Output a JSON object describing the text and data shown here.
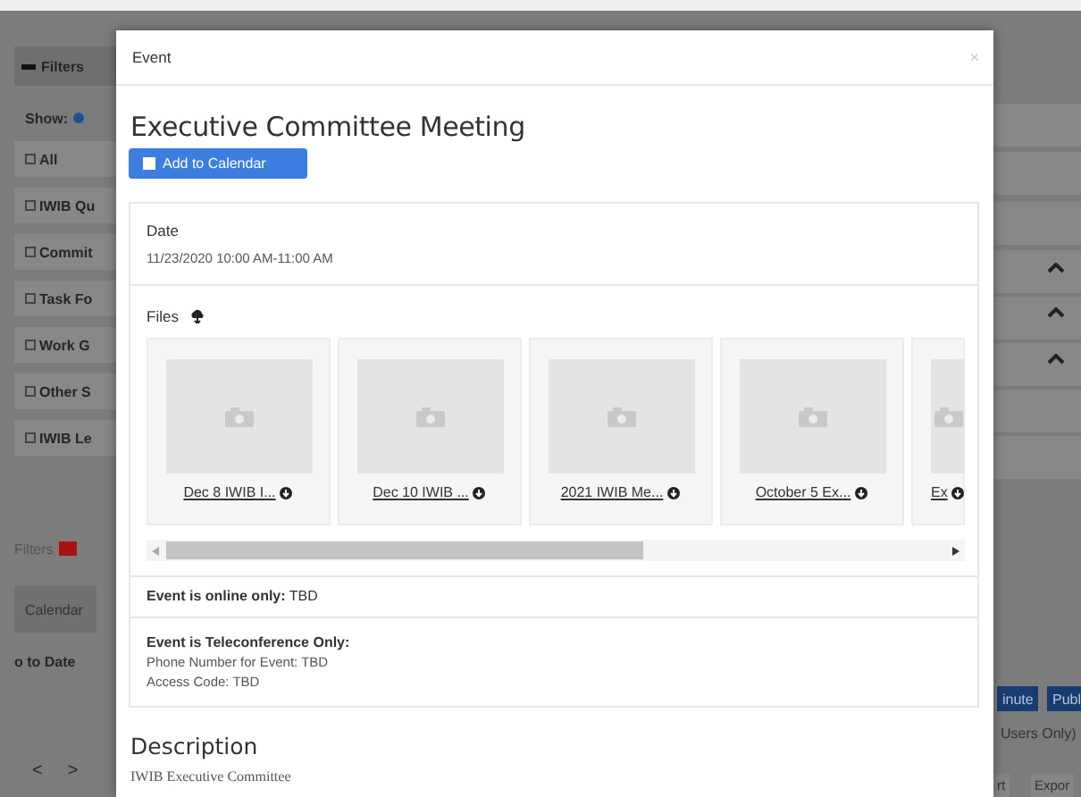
{
  "background": {
    "filters_toggle": "Filters",
    "show_label": "Show:",
    "filter_options": [
      {
        "label": "All",
        "checked": false
      },
      {
        "label": "IWIB Qu",
        "checked": false
      },
      {
        "label": "Commit",
        "checked": false
      },
      {
        "label": "Task Fo",
        "checked": false
      },
      {
        "label": "Work G",
        "checked": false
      },
      {
        "label": "Other S",
        "checked": false
      },
      {
        "label": "IWIB Le",
        "checked": false
      }
    ],
    "filters_label": "Filters",
    "calendar_tab": "Calendar",
    "go_to_date": "o to Date",
    "nav": [
      "<",
      ">"
    ],
    "right_buttons": [
      "inute",
      "Publ"
    ],
    "right_note": "Users Only)",
    "bottom_buttons": [
      "rt",
      "Expor"
    ]
  },
  "modal": {
    "title": "Event",
    "close": "×",
    "event_title": "Executive Committee Meeting",
    "add_button": "Add to Calendar",
    "date_label": "Date",
    "date_value": "11/23/2020 10:00 AM-11:00 AM",
    "files_label": "Files",
    "files": [
      {
        "kind": "full",
        "name": "Dec 8 IWIB I..."
      },
      {
        "kind": "full",
        "name": "Dec 10 IWIB ..."
      },
      {
        "kind": "full",
        "name": "2021 IWIB Me..."
      },
      {
        "kind": "full",
        "name": "October 5 Ex..."
      },
      {
        "kind": "partial",
        "name": "Ex"
      }
    ],
    "online": "**Event is online only:** TBD",
    "teleconference_heading": "Event is Teleconference Only:",
    "teleconference_lines": [
      "Phone Number for Event: TBD",
      "Access Code: TBD"
    ],
    "description_heading": "Description",
    "description": "IWIB Executive Committee"
  }
}
